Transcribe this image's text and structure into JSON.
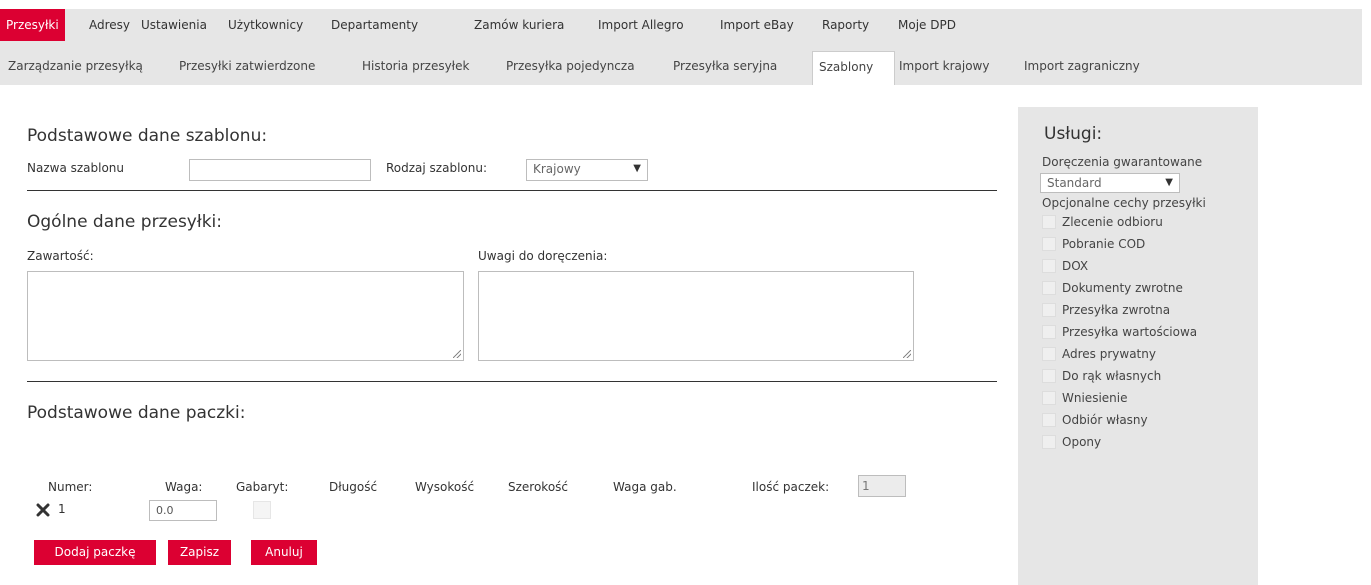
{
  "nav": {
    "top": [
      "Przesyłki",
      "Adresy",
      "Ustawienia",
      "Użytkownicy",
      "Departamenty",
      "Zamów kuriera",
      "Import Allegro",
      "Import eBay",
      "Raporty",
      "Moje DPD"
    ],
    "sub": [
      "Zarządzanie przesyłką",
      "Przesyłki zatwierdzone",
      "Historia przesyłek",
      "Przesyłka pojedyncza",
      "Przesyłka seryjna",
      "Szablony",
      "Import krajowy",
      "Import zagraniczny"
    ]
  },
  "template": {
    "heading": "Podstawowe dane szablonu:",
    "name_label": "Nazwa szablonu",
    "name_value": "",
    "type_label": "Rodzaj szablonu:",
    "type_value": "Krajowy"
  },
  "general": {
    "heading": "Ogólne dane przesyłki:",
    "content_label": "Zawartość:",
    "content_value": "",
    "notes_label": "Uwagi do doręczenia:",
    "notes_value": ""
  },
  "parcel": {
    "heading": "Podstawowe dane paczki:",
    "headers": {
      "number": "Numer:",
      "weight": "Waga:",
      "size": "Gabaryt:",
      "length": "Długość",
      "height": "Wysokość",
      "width": "Szerokość",
      "dim_weight": "Waga gab.",
      "count": "Ilość paczek:"
    },
    "count_value": "1",
    "row": {
      "number": "1",
      "weight": "0.0",
      "remove_icon": "close-x-icon"
    }
  },
  "buttons": {
    "add": "Dodaj paczkę",
    "save": "Zapisz",
    "cancel": "Anuluj"
  },
  "services": {
    "heading": "Usługi:",
    "guaranteed_label": "Doręczenia gwarantowane",
    "guaranteed_value": "Standard",
    "optional_label": "Opcjonalne cechy przesyłki",
    "options": [
      "Zlecenie odbioru",
      "Pobranie COD",
      "DOX",
      "Dokumenty zwrotne",
      "Przesyłka zwrotna",
      "Przesyłka wartościowa",
      "Adres prywatny",
      "Do rąk własnych",
      "Wniesienie",
      "Odbiór własny",
      "Opony"
    ]
  },
  "colors": {
    "accent": "#dc0032",
    "nav_bg": "#e6e6e6"
  }
}
